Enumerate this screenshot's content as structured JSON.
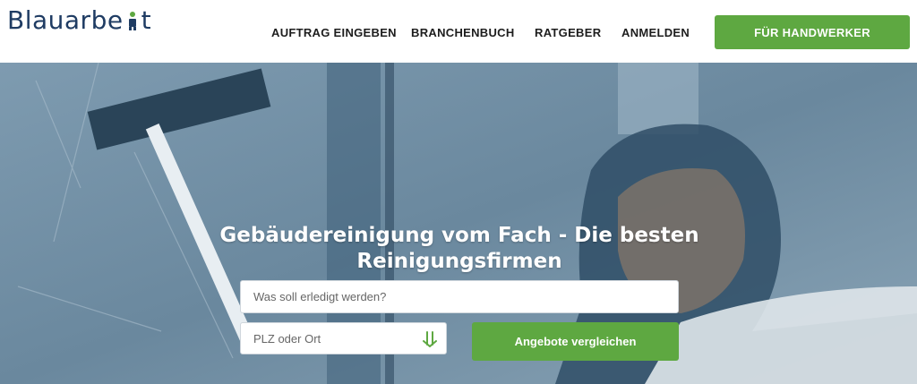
{
  "brand": {
    "name_before": "Blauarbe",
    "name_after": "t"
  },
  "nav": {
    "items": [
      "AUFTRAG EINGEBEN",
      "BRANCHENBUCH",
      "RATGEBER",
      "ANMELDEN"
    ],
    "cta_label": "FÜR HANDWERKER"
  },
  "hero": {
    "headline": "Gebäudereinigung vom Fach - Die besten Reinigungsfirmen",
    "task_placeholder": "Was soll erledigt werden?",
    "location_placeholder": "PLZ oder Ort",
    "submit_label": "Angebote vergleichen"
  },
  "colors": {
    "brand_blue": "#1f3c63",
    "accent_green": "#5ea841",
    "hero_tint": "#5f7f97"
  }
}
